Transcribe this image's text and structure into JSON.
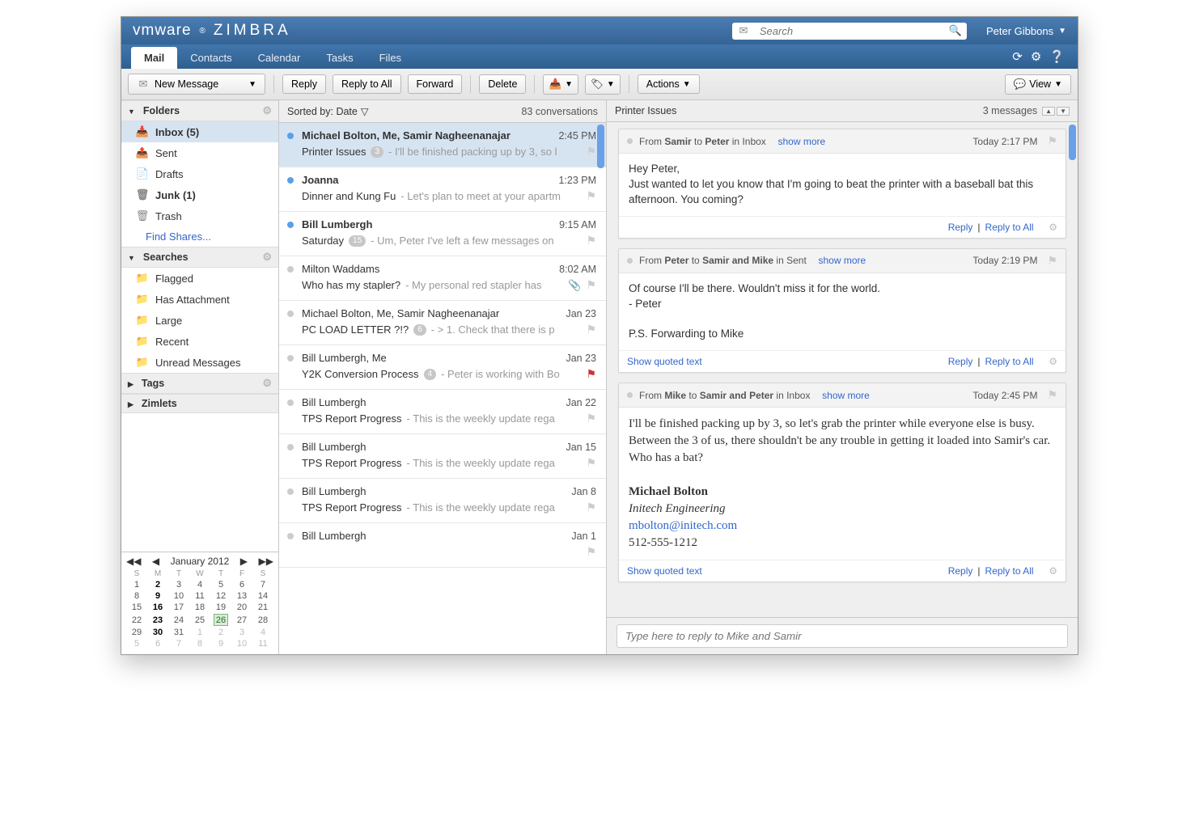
{
  "brand": {
    "vmware": "vmware",
    "zimbra": "ZIMBRA"
  },
  "search": {
    "placeholder": "Search"
  },
  "user": {
    "name": "Peter Gibbons"
  },
  "nav": {
    "tabs": [
      "Mail",
      "Contacts",
      "Calendar",
      "Tasks",
      "Files"
    ],
    "active": 0
  },
  "toolbar": {
    "new_message": "New Message",
    "reply": "Reply",
    "reply_all": "Reply to All",
    "forward": "Forward",
    "delete": "Delete",
    "actions": "Actions",
    "view": "View"
  },
  "sidebar": {
    "folders_label": "Folders",
    "searches_label": "Searches",
    "tags_label": "Tags",
    "zimlets_label": "Zimlets",
    "find_shares": "Find Shares...",
    "folders": [
      {
        "label": "Inbox (5)",
        "bold": true,
        "icon": "inbox",
        "selected": true
      },
      {
        "label": "Sent",
        "bold": false,
        "icon": "sent"
      },
      {
        "label": "Drafts",
        "bold": false,
        "icon": "drafts"
      },
      {
        "label": "Junk (1)",
        "bold": true,
        "icon": "junk"
      },
      {
        "label": "Trash",
        "bold": false,
        "icon": "trash"
      }
    ],
    "searches": [
      {
        "label": "Flagged"
      },
      {
        "label": "Has Attachment"
      },
      {
        "label": "Large"
      },
      {
        "label": "Recent"
      },
      {
        "label": "Unread Messages"
      }
    ]
  },
  "list": {
    "sort_label": "Sorted by: Date",
    "count": "83 conversations",
    "messages": [
      {
        "sender": "Michael Bolton, Me, Samir Nagheenanajar",
        "time": "2:45 PM",
        "subject": "Printer Issues",
        "badge": "3",
        "preview": "- I'll be finished packing up by 3, so l",
        "unread": true,
        "selected": true,
        "flag": "gray"
      },
      {
        "sender": "Joanna",
        "time": "1:23 PM",
        "subject": "Dinner and Kung Fu",
        "preview": "- Let's plan to meet at your apartm",
        "unread": true,
        "flag": "gray"
      },
      {
        "sender": "Bill Lumbergh",
        "time": "9:15 AM",
        "subject": "Saturday",
        "badge": "15",
        "preview": "- Um, Peter I've left a few messages on",
        "unread": true,
        "flag": "gray"
      },
      {
        "sender": "Milton Waddams",
        "time": "8:02 AM",
        "subject": "Who has my stapler?",
        "preview": "- My personal red stapler has",
        "unread": false,
        "attach": true,
        "flag": "gray"
      },
      {
        "sender": "Michael Bolton, Me, Samir Nagheenanajar",
        "time": "Jan 23",
        "subject": "PC LOAD LETTER ?!?",
        "badge": "6",
        "preview": "- > 1. Check that there is p",
        "unread": false,
        "flag": "gray"
      },
      {
        "sender": "Bill Lumbergh, Me",
        "time": "Jan 23",
        "subject": "Y2K Conversion Process",
        "badge": "4",
        "preview": "- Peter is working with Bo",
        "unread": false,
        "flag": "red"
      },
      {
        "sender": "Bill Lumbergh",
        "time": "Jan 22",
        "subject": "TPS Report Progress",
        "preview": "- This is the weekly update rega",
        "unread": false,
        "flag": "gray"
      },
      {
        "sender": "Bill Lumbergh",
        "time": "Jan 15",
        "subject": "TPS Report Progress",
        "preview": "- This is the weekly update rega",
        "unread": false,
        "flag": "gray"
      },
      {
        "sender": "Bill Lumbergh",
        "time": "Jan 8",
        "subject": "TPS Report Progress",
        "preview": "- This is the weekly update rega",
        "unread": false,
        "flag": "gray"
      },
      {
        "sender": "Bill Lumbergh",
        "time": "Jan 1",
        "subject": "",
        "preview": "",
        "unread": false,
        "flag": "gray"
      }
    ]
  },
  "reader": {
    "subject": "Printer Issues",
    "count": "3 messages",
    "reply_placeholder": "Type here to reply to Mike and Samir",
    "show_quoted": "Show quoted text",
    "reply_link": "Reply",
    "reply_all_link": "Reply to All",
    "show_more": "show more",
    "cards": [
      {
        "head_prefix": "From ",
        "from": "Samir",
        "to_label": " to ",
        "to": "Peter",
        "in": " in Inbox",
        "time": "Today 2:17 PM",
        "body": "Hey Peter,\nJust wanted to let you know that I'm going to beat the printer with a baseball bat this afternoon.  You coming?",
        "show_quoted": false
      },
      {
        "head_prefix": "From ",
        "from": "Peter",
        "to_label": " to ",
        "to": "Samir and Mike",
        "in": " in Sent",
        "time": "Today 2:19 PM",
        "body": "Of course I'll be there.  Wouldn't miss it for the world.\n- Peter\n\nP.S. Forwarding to Mike",
        "show_quoted": true
      },
      {
        "head_prefix": "From ",
        "from": "Mike",
        "to_label": " to ",
        "to": "Samir and Peter",
        "in": " in Inbox",
        "time": "Today 2:45 PM",
        "serif": true,
        "body": "I'll be finished packing up by 3, so let's grab the printer while everyone else is busy.  Between the 3 of us, there shouldn't be any trouble in getting it loaded into Samir's car.  Who has a bat?",
        "sig": {
          "name": "Michael Bolton",
          "co": "Initech Engineering",
          "email": "mbolton@initech.com",
          "phone": "512-555-1212"
        },
        "show_quoted": true
      }
    ]
  },
  "cal": {
    "title": "January 2012",
    "dow": [
      "S",
      "M",
      "T",
      "W",
      "T",
      "F",
      "S"
    ],
    "rows": [
      [
        {
          "d": "1"
        },
        {
          "d": "2",
          "b": 1
        },
        {
          "d": "3"
        },
        {
          "d": "4"
        },
        {
          "d": "5"
        },
        {
          "d": "6"
        },
        {
          "d": "7"
        }
      ],
      [
        {
          "d": "8"
        },
        {
          "d": "9",
          "b": 1
        },
        {
          "d": "10"
        },
        {
          "d": "11"
        },
        {
          "d": "12"
        },
        {
          "d": "13"
        },
        {
          "d": "14"
        }
      ],
      [
        {
          "d": "15"
        },
        {
          "d": "16",
          "b": 1
        },
        {
          "d": "17"
        },
        {
          "d": "18"
        },
        {
          "d": "19"
        },
        {
          "d": "20"
        },
        {
          "d": "21"
        }
      ],
      [
        {
          "d": "22"
        },
        {
          "d": "23",
          "b": 1
        },
        {
          "d": "24"
        },
        {
          "d": "25"
        },
        {
          "d": "26",
          "t": 1
        },
        {
          "d": "27"
        },
        {
          "d": "28"
        }
      ],
      [
        {
          "d": "29"
        },
        {
          "d": "30",
          "b": 1
        },
        {
          "d": "31"
        },
        {
          "d": "1",
          "m": 1
        },
        {
          "d": "2",
          "m": 1
        },
        {
          "d": "3",
          "m": 1
        },
        {
          "d": "4",
          "m": 1
        }
      ],
      [
        {
          "d": "5",
          "m": 1
        },
        {
          "d": "6",
          "m": 1
        },
        {
          "d": "7",
          "m": 1
        },
        {
          "d": "8",
          "m": 1
        },
        {
          "d": "9",
          "m": 1
        },
        {
          "d": "10",
          "m": 1
        },
        {
          "d": "11",
          "m": 1
        }
      ]
    ]
  }
}
